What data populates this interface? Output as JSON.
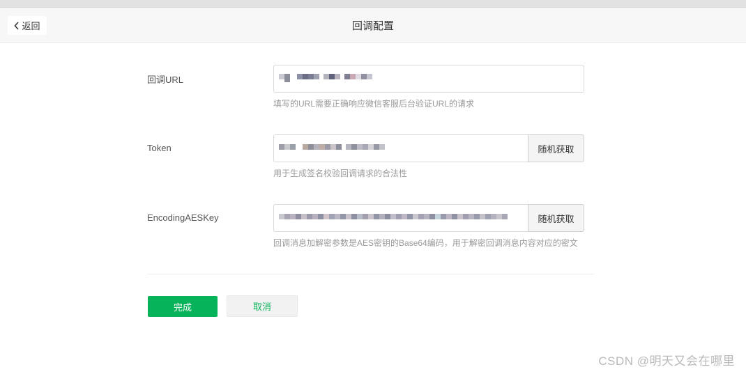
{
  "header": {
    "back_label": "返回",
    "title": "回调配置"
  },
  "form": {
    "url": {
      "label": "回调URL",
      "hint": "填写的URL需要正确响应微信客服后台验证URL的请求"
    },
    "token": {
      "label": "Token",
      "button_label": "随机获取",
      "hint": "用于生成签名校验回调请求的合法性"
    },
    "aes_key": {
      "label": "EncodingAESKey",
      "button_label": "随机获取",
      "hint": "回调消息加解密参数是AES密钥的Base64编码，用于解密回调消息内容对应的密文"
    }
  },
  "actions": {
    "confirm_label": "完成",
    "cancel_label": "取消"
  },
  "watermark": "CSDN @明天又会在哪里",
  "colors": {
    "primary": "#07b35a",
    "hint": "#9a9a9a",
    "header_bg": "#f7f7f7"
  },
  "icons": {
    "back": "chevron-left-icon"
  }
}
